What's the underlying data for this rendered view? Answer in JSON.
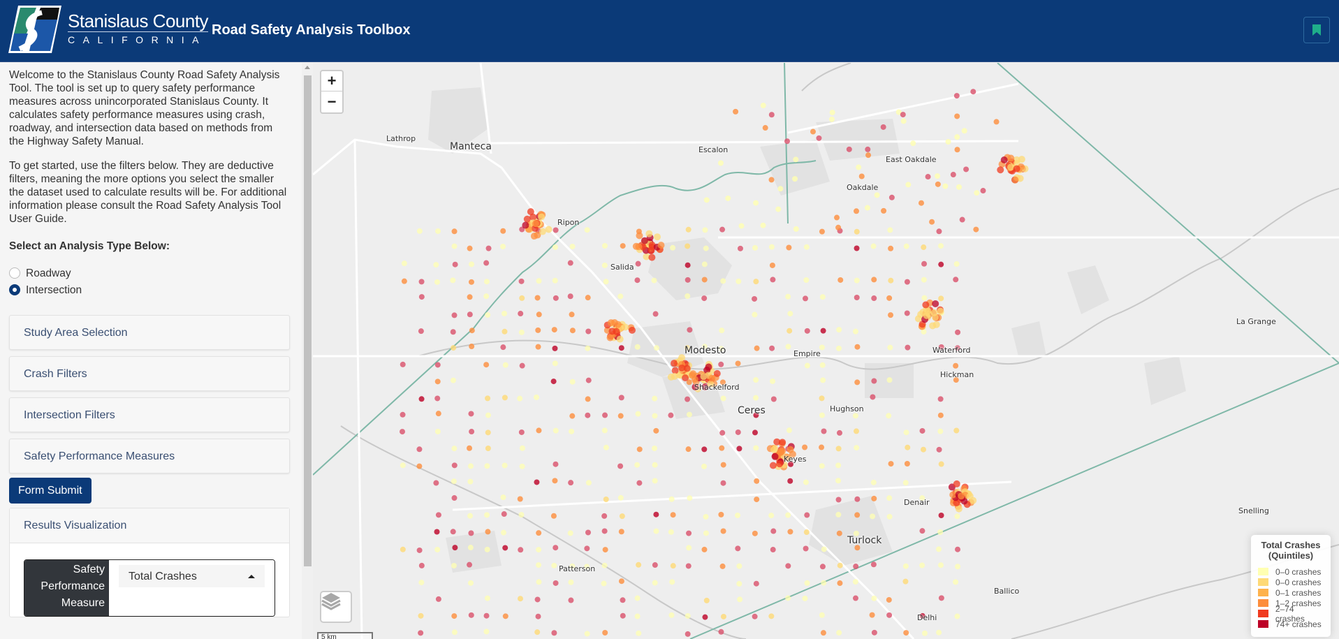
{
  "header": {
    "logo_title": "Stanislaus County",
    "logo_subtitle": "CALIFORNIA",
    "app_title": "Road Safety Analysis Toolbox",
    "bookmark_icon": "bookmark-icon"
  },
  "sidebar": {
    "intro_1": "Welcome to the Stanislaus County Road Safety Analysis Tool. The tool is set up to query safety performance measures across unincorporated Stanislaus County. It calculates safety performance measures using crash, roadway, and intersection data based on methods from the Highway Safety Manual.",
    "intro_2": "To get started, use the filters below. They are deductive filters, meaning the more options you select the smaller the dataset used to calculate results will be. For additional information please consult the Road Safety Analysis Tool User Guide.",
    "analysis_label": "Select an Analysis Type Below:",
    "analysis_options": [
      {
        "label": "Roadway",
        "checked": false
      },
      {
        "label": "Intersection",
        "checked": true
      }
    ],
    "accordion": [
      {
        "label": "Study Area Selection"
      },
      {
        "label": "Crash Filters"
      },
      {
        "label": "Intersection Filters"
      },
      {
        "label": "Safety Performance Measures"
      }
    ],
    "submit_label": "Form Submit",
    "results": {
      "title": "Results Visualization",
      "spm_label": "Safety Performance Measure",
      "spm_value": "Total Crashes"
    }
  },
  "map": {
    "zoom_in": "+",
    "zoom_out": "−",
    "scale_label": "5 km",
    "labels": [
      {
        "text": "Lathrop",
        "big": false
      },
      {
        "text": "Manteca",
        "big": true
      },
      {
        "text": "Escalon",
        "big": false
      },
      {
        "text": "East Oakdale",
        "big": false
      },
      {
        "text": "Oakdale",
        "big": false
      },
      {
        "text": "Ripon",
        "big": false
      },
      {
        "text": "Salida",
        "big": false
      },
      {
        "text": "Modesto",
        "big": true
      },
      {
        "text": "Empire",
        "big": false
      },
      {
        "text": "Waterford",
        "big": false
      },
      {
        "text": "Hickman",
        "big": false
      },
      {
        "text": "La Grange",
        "big": false
      },
      {
        "text": "Shackelford",
        "big": false
      },
      {
        "text": "Ceres",
        "big": true
      },
      {
        "text": "Hughson",
        "big": false
      },
      {
        "text": "Keyes",
        "big": false
      },
      {
        "text": "Denair",
        "big": false
      },
      {
        "text": "Snelling",
        "big": false
      },
      {
        "text": "Turlock",
        "big": true
      },
      {
        "text": "Patterson",
        "big": false
      },
      {
        "text": "Ballico",
        "big": false
      },
      {
        "text": "Delhi",
        "big": false
      }
    ],
    "legend": {
      "title_line1": "Total Crashes",
      "title_line2": "(Quintiles)",
      "items": [
        {
          "label": "0–0 crashes",
          "color": "#ffffb2"
        },
        {
          "label": "0–0 crashes",
          "color": "#fed976"
        },
        {
          "label": "0–1 crashes",
          "color": "#feb24c"
        },
        {
          "label": "1–2 crashes",
          "color": "#fd8d3c"
        },
        {
          "label": "2–74 crashes",
          "color": "#f03b20"
        },
        {
          "label": "74+ crashes",
          "color": "#bd0026"
        }
      ]
    }
  },
  "colors": {
    "header_bg": "#0b3a78",
    "accent_teal": "#1fae8a",
    "county_boundary": "#6fb5a0"
  }
}
